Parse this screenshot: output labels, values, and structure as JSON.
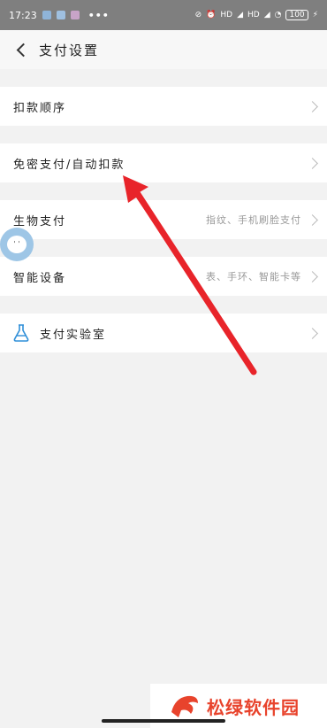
{
  "status_bar": {
    "time": "17:23",
    "dots": "•••",
    "network_1": "HD",
    "network_2": "HD",
    "battery": "100"
  },
  "header": {
    "title": "支付设置"
  },
  "rows": [
    {
      "label": "扣款顺序",
      "sub": ""
    },
    {
      "label": "免密支付/自动扣款",
      "sub": ""
    },
    {
      "label": "生物支付",
      "sub": "指纹、手机刷脸支付"
    },
    {
      "label": "智能设备",
      "sub": "表、手环、智能卡等"
    },
    {
      "label": "支付实验室",
      "sub": ""
    }
  ],
  "bubble": {
    "text": "' '"
  },
  "watermark": {
    "text": "松绿软件园"
  },
  "colors": {
    "arrow": "#e8242a",
    "watermark": "#e8432c",
    "flask": "#2f8fd8",
    "background": "#f2f2f2"
  },
  "icons": {
    "back": "chevron-left-icon",
    "row_arrow": "chevron-right-icon",
    "lab": "flask-icon"
  }
}
